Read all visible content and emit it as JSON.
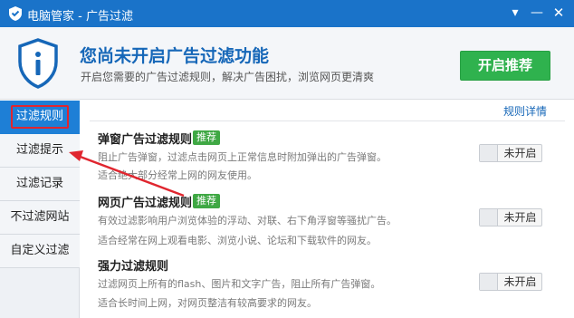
{
  "window": {
    "title": "电脑管家 - 广告过滤",
    "controls": {
      "menu": "▾",
      "minimize": "—",
      "close": "✕"
    }
  },
  "banner": {
    "headline": "您尚未开启广告过滤功能",
    "subline": "开启您需要的广告过滤规则，解决广告困扰，浏览网页更清爽",
    "enable_button": "开启推荐"
  },
  "sidebar": {
    "items": [
      {
        "label": "过滤规则",
        "active": true
      },
      {
        "label": "过滤提示",
        "active": false
      },
      {
        "label": "过滤记录",
        "active": false
      },
      {
        "label": "不过滤网站",
        "active": false
      },
      {
        "label": "自定义过滤",
        "active": false
      }
    ]
  },
  "content": {
    "detail_link": "规则详情",
    "rules": [
      {
        "title": "弹窗广告过滤规则",
        "tag": "推荐",
        "desc1": "阻止广告弹窗，过滤点击网页上正常信息时附加弹出的广告弹窗。",
        "desc2": "适合绝大部分经常上网的网友使用。",
        "state": "未开启"
      },
      {
        "title": "网页广告过滤规则",
        "tag": "推荐",
        "desc1": "有效过滤影响用户浏览体验的浮动、对联、右下角浮窗等骚扰广告。",
        "desc2": "适合经常在网上观看电影、浏览小说、论坛和下载软件的网友。",
        "state": "未开启"
      },
      {
        "title": "强力过滤规则",
        "tag": "",
        "desc1": "过滤网页上所有的flash、图片和文字广告，阻止所有广告弹窗。",
        "desc2": "适合长时间上网，对网页整洁有较高要求的网友。",
        "state": "未开启"
      }
    ]
  },
  "colors": {
    "titlebar": "#1a73c9",
    "accent_green": "#2fb24e",
    "active_tab": "#1e7fd6",
    "highlight_red": "#e0262f"
  }
}
